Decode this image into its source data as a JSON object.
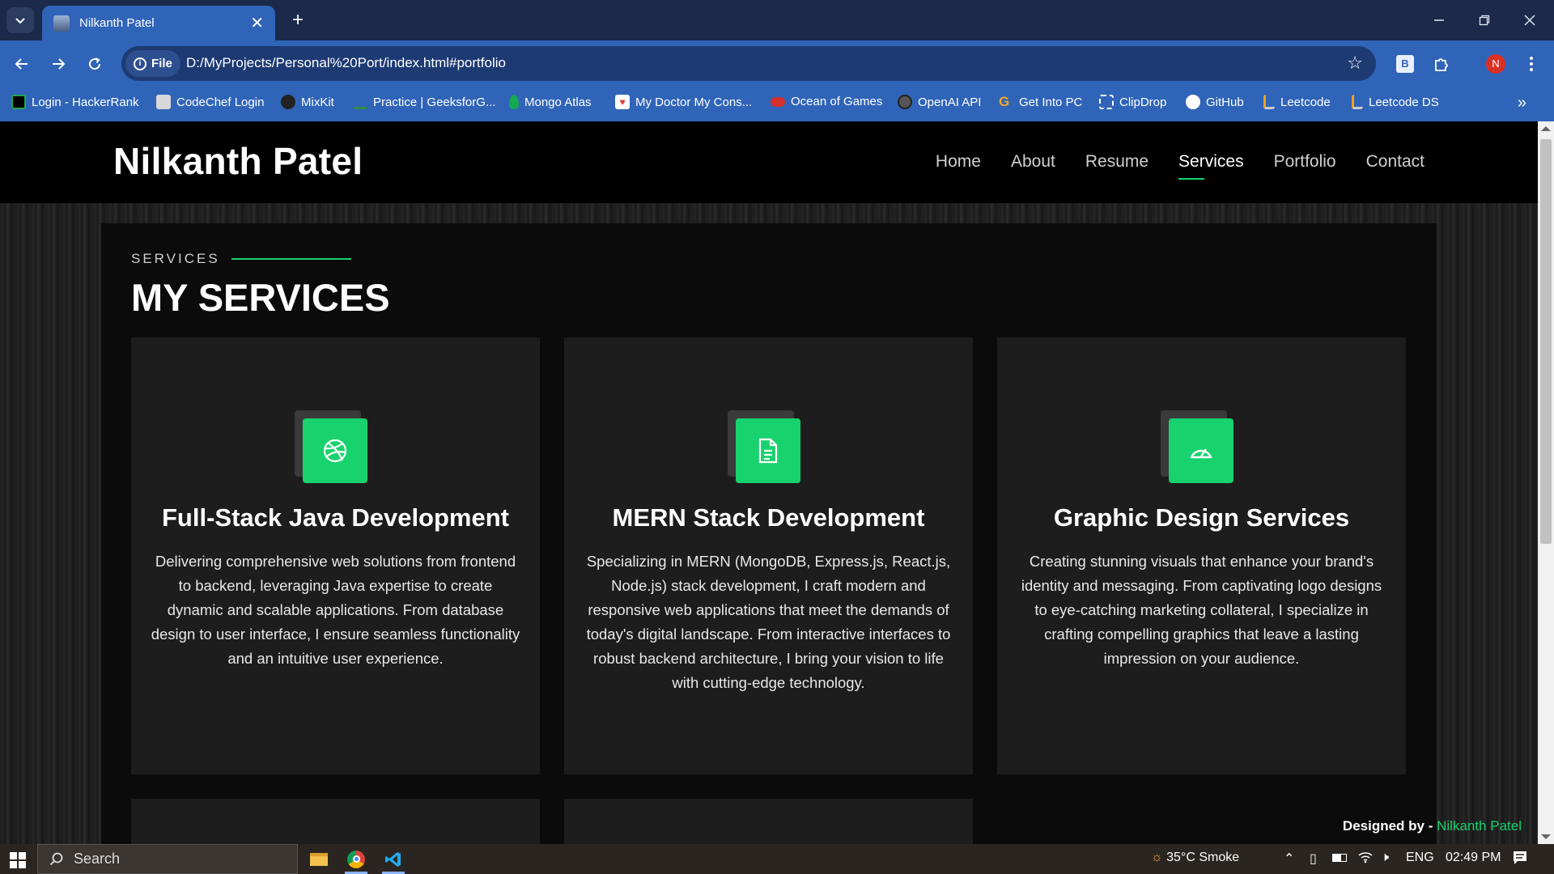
{
  "browser": {
    "tab_title": "Nilkanth Patel",
    "new_tab_label": "+",
    "close_tab_label": "✕",
    "chip_label": "File",
    "url": "D:/MyProjects/Personal%20Port/index.html#portfolio",
    "extension_label": "B",
    "profile_initial": "N",
    "bookmarks": [
      {
        "label": "Login - HackerRank",
        "icon": "hackerrank-icon",
        "color": "#1ba94c"
      },
      {
        "label": "CodeChef Login",
        "icon": "codechef-icon",
        "color": "#7c5a3c"
      },
      {
        "label": "MixKit",
        "icon": "mixkit-icon",
        "color": "#222222"
      },
      {
        "label": "Practice | GeeksforG...",
        "icon": "geeksforgeeks-icon",
        "color": "#2f8d46"
      },
      {
        "label": "Mongo Atlas",
        "icon": "mongodb-leaf-icon",
        "color": "#13aa52"
      },
      {
        "label": "My Doctor My Cons...",
        "icon": "heart-icon",
        "color": "#e53935"
      },
      {
        "label": "Ocean of Games",
        "icon": "gamepad-icon",
        "color": "#d32f2f"
      },
      {
        "label": "OpenAI API",
        "icon": "openai-icon",
        "color": "#222222"
      },
      {
        "label": "Get Into PC",
        "icon": "getintopc-icon",
        "color": "#f5a623"
      },
      {
        "label": "ClipDrop",
        "icon": "clipdrop-icon",
        "color": "#ffffff"
      },
      {
        "label": "GitHub",
        "icon": "github-icon",
        "color": "#ffffff"
      },
      {
        "label": "Leetcode",
        "icon": "leetcode-icon",
        "color": "#ffa116"
      },
      {
        "label": "Leetcode DS",
        "icon": "leetcode-icon",
        "color": "#ffa116"
      }
    ],
    "bookmarks_overflow": "»"
  },
  "site": {
    "logo": "Nilkanth Patel",
    "nav": [
      "Home",
      "About",
      "Resume",
      "Services",
      "Portfolio",
      "Contact"
    ],
    "active_nav": "Services",
    "section_label": "SERVICES",
    "section_title": "MY SERVICES",
    "services": [
      {
        "icon": "dribbble-icon",
        "title": "Full-Stack Java Development",
        "text": "Delivering comprehensive web solutions from frontend to backend, leveraging Java expertise to create dynamic and scalable applications. From database design to user interface, I ensure seamless functionality and an intuitive user experience."
      },
      {
        "icon": "document-icon",
        "title": "MERN Stack Development",
        "text": "Specializing in MERN (MongoDB, Express.js, React.js, Node.js) stack development, I craft modern and responsive web applications that meet the demands of today's digital landscape. From interactive interfaces to robust backend architecture, I bring your vision to life with cutting-edge technology."
      },
      {
        "icon": "speedometer-icon",
        "title": "Graphic Design Services",
        "text": "Creating stunning visuals that enhance your brand's identity and messaging. From captivating logo designs to eye-catching marketing collateral, I specialize in crafting compelling graphics that leave a lasting impression on your audience."
      }
    ],
    "credit_prefix": "Designed by - ",
    "credit_name": "Nilkanth Patel",
    "accent_color": "#18d26e"
  },
  "taskbar": {
    "search_label": "Search",
    "weather": "35°C  Smoke",
    "language": "ENG",
    "time": "02:49 PM"
  }
}
